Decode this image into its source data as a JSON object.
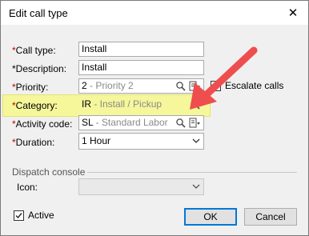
{
  "window": {
    "title": "Edit call type",
    "close_glyph": "✕"
  },
  "form": {
    "call_type": {
      "label": "Call type:",
      "value": "Install"
    },
    "description": {
      "label": "*Description:",
      "value": "Install"
    },
    "priority": {
      "label": "Priority:",
      "code": "2",
      "desc": "- Priority 2"
    },
    "escalate": {
      "label": "Escalate calls",
      "checked": false
    },
    "category": {
      "label": "Category:",
      "code": "IR",
      "desc": "- Install / Pickup"
    },
    "activity": {
      "label": "Activity code:",
      "code": "SL",
      "desc": "- Standard Labor"
    },
    "duration": {
      "label": "Duration:",
      "value": "1 Hour"
    }
  },
  "dispatch": {
    "section_title": "Dispatch console",
    "icon_label": "Icon:",
    "icon_value": ""
  },
  "footer": {
    "active_label": "Active",
    "active_checked": true,
    "ok_label": "OK",
    "cancel_label": "Cancel"
  },
  "colors": {
    "highlight": "#f6f79b",
    "arrow": "#ef4e4e",
    "required": "#c00000"
  },
  "icons": [
    "close-icon",
    "search-icon",
    "document-icon",
    "dropdown-arrow-icon",
    "checkmark-icon"
  ]
}
